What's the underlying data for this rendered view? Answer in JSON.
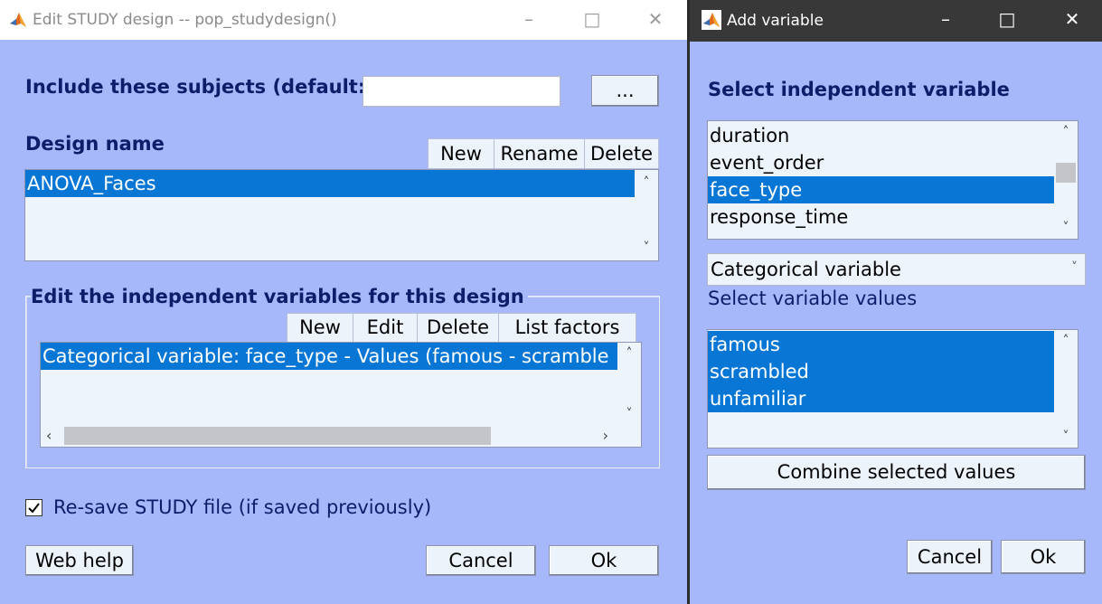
{
  "left_window": {
    "title": "Edit STUDY design -- pop_studydesign()",
    "include_label": "Include these subjects (default: a",
    "include_value": "",
    "browse_label": "...",
    "design_name_label": "Design name",
    "design_buttons": {
      "new": "New",
      "rename": "Rename",
      "delete": "Delete"
    },
    "designs": [
      "ANOVA_Faces"
    ],
    "edit_group_label": "Edit the independent variables for this design",
    "var_buttons": {
      "new": "New",
      "edit": "Edit",
      "delete": "Delete",
      "list": "List factors"
    },
    "variables": [
      "Categorical variable: face_type - Values (famous - scramble"
    ],
    "resave_label": "Re-save STUDY file (if saved previously)",
    "resave_checked": true,
    "webhelp_label": "Web help",
    "cancel_label": "Cancel",
    "ok_label": "Ok"
  },
  "right_window": {
    "title": "Add variable",
    "select_label": "Select independent variable",
    "variables": [
      "duration",
      "event_order",
      "face_type",
      "response_time"
    ],
    "selected_variable": "face_type",
    "var_type": "Categorical variable",
    "values_label": "Select variable values",
    "values": [
      "famous",
      "scrambled",
      "unfamiliar"
    ],
    "combine_label": "Combine selected values",
    "cancel_label": "Cancel",
    "ok_label": "Ok"
  },
  "colors": {
    "dialog_bg": "#a6b8fa",
    "selection": "#0876d5",
    "label_text": "#0d1d6a",
    "title_bar_active": "#383838"
  }
}
